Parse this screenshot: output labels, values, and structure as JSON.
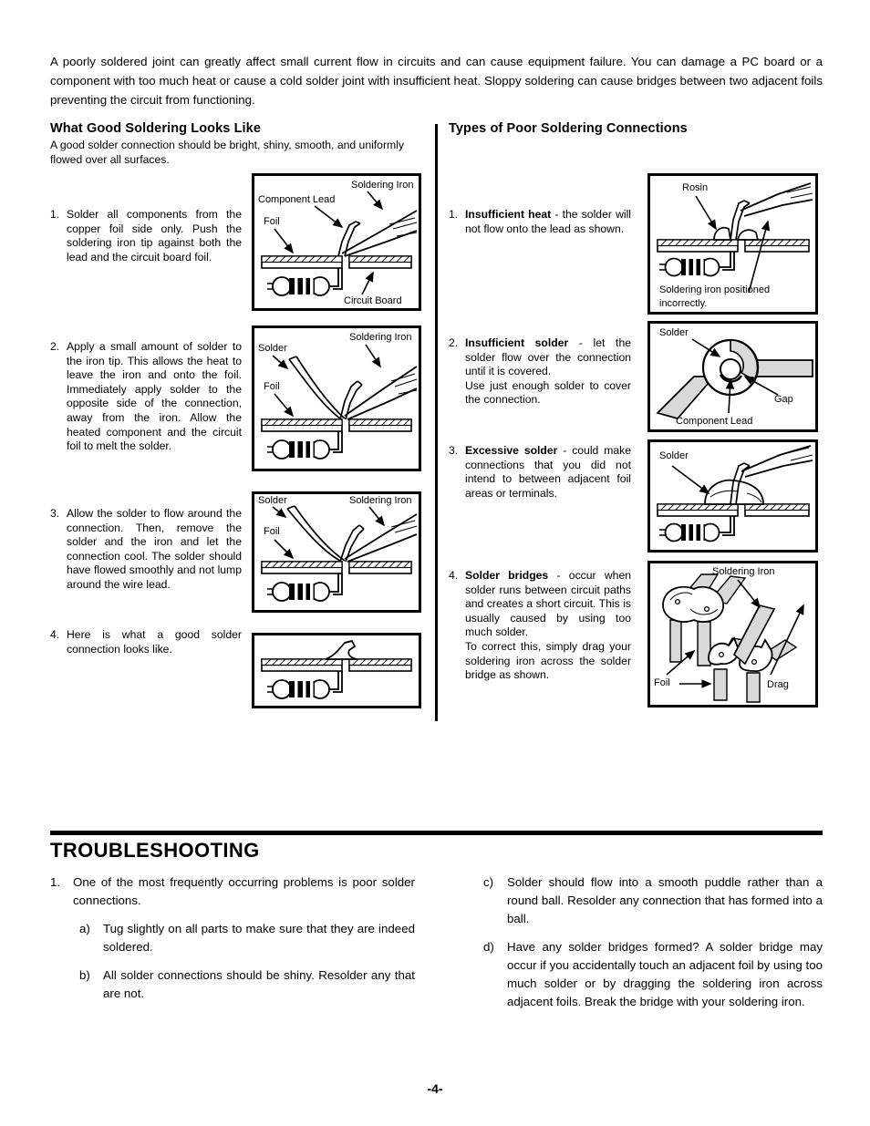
{
  "intro": "A poorly soldered joint can greatly affect small current flow in circuits and can cause equipment failure.  You can damage a PC board or a component with too much heat or cause a cold solder joint with insufficient heat.  Sloppy soldering can cause bridges between two adjacent foils preventing the circuit from functioning.",
  "good": {
    "heading": "What Good Soldering Looks Like",
    "subtext": "A good solder connection should be bright, shiny, smooth, and uniformly flowed over all surfaces.",
    "steps": [
      {
        "num": "1.",
        "text": "Solder all components from the copper foil side only.  Push the soldering iron tip against both the lead and the circuit board foil."
      },
      {
        "num": "2.",
        "text": "Apply a small amount of solder to the iron tip. This allows the heat to leave the iron and onto the foil. Immediately apply solder to the opposite side of the connection, away from the iron. Allow the heated component and the circuit foil to melt the solder."
      },
      {
        "num": "3.",
        "text": "Allow the solder to flow around the connection.  Then, remove the solder and the iron and let the connection cool. The solder should have flowed smoothly and not lump around the wire lead."
      },
      {
        "num": "4.",
        "text": "Here is what a good solder connection looks like."
      }
    ],
    "figures": {
      "fig1": {
        "label_iron": "Soldering Iron",
        "label_lead": "Component Lead",
        "label_foil": "Foil",
        "label_board": "Circuit Board"
      },
      "fig2": {
        "label_iron": "Soldering Iron",
        "label_solder": "Solder",
        "label_foil": "Foil"
      },
      "fig3": {
        "label_iron": "Soldering Iron",
        "label_solder": "Solder",
        "label_foil": "Foil"
      },
      "fig4": {}
    }
  },
  "poor": {
    "heading": "Types of Poor Soldering Connections",
    "items": [
      {
        "num": "1.",
        "bold": "Insufficient heat",
        "text": " - the solder will not flow onto the lead as shown.",
        "text2": ""
      },
      {
        "num": "2.",
        "bold": "Insufficient solder",
        "text": " - let the solder flow over the connection until it is covered.",
        "text2": "Use just enough solder to cover the connection."
      },
      {
        "num": "3.",
        "bold": "Excessive solder",
        "text": " - could make connections that you did not intend to between adjacent foil areas or terminals.",
        "text2": ""
      },
      {
        "num": "4.",
        "bold": "Solder bridges",
        "text": " - occur when solder runs between circuit paths and creates a short circuit. This is usually caused by using too much solder.",
        "text2": "To correct this, simply drag your soldering iron across the solder bridge as shown."
      }
    ],
    "figures": {
      "fig1": {
        "label_rosin": "Rosin",
        "caption": "Soldering  iron  positioned incorrectly."
      },
      "fig2": {
        "label_solder": "Solder",
        "label_gap": "Gap",
        "label_lead": "Component Lead"
      },
      "fig3": {
        "label_solder": "Solder"
      },
      "fig4": {
        "label_iron": "Soldering Iron",
        "label_foil": "Foil",
        "label_drag": "Drag"
      }
    }
  },
  "troubleshooting": {
    "title": "TROUBLESHOOTING",
    "left": [
      {
        "mark": "1.",
        "text": "One of the most frequently occurring problems is poor solder connections.",
        "level": 1
      },
      {
        "mark": "a)",
        "text": "Tug slightly on all parts to make sure that they are indeed soldered.",
        "level": 2
      },
      {
        "mark": "b)",
        "text": "All solder connections should be shiny. Resolder any that are not.",
        "level": 2
      }
    ],
    "right": [
      {
        "mark": "c)",
        "text": "Solder should flow into a smooth puddle rather than a round ball.  Resolder any connection that has formed into a ball."
      },
      {
        "mark": "d)",
        "text": "Have any solder bridges formed?  A solder bridge may occur if you accidentally touch an adjacent foil by using too much solder or by dragging the soldering iron across adjacent foils. Break the bridge with your soldering iron."
      }
    ]
  },
  "footer": {
    "page": "-4-"
  },
  "colors": {
    "ink": "#000000",
    "paper": "#ffffff",
    "trace_fill": "#d9d9d9"
  }
}
